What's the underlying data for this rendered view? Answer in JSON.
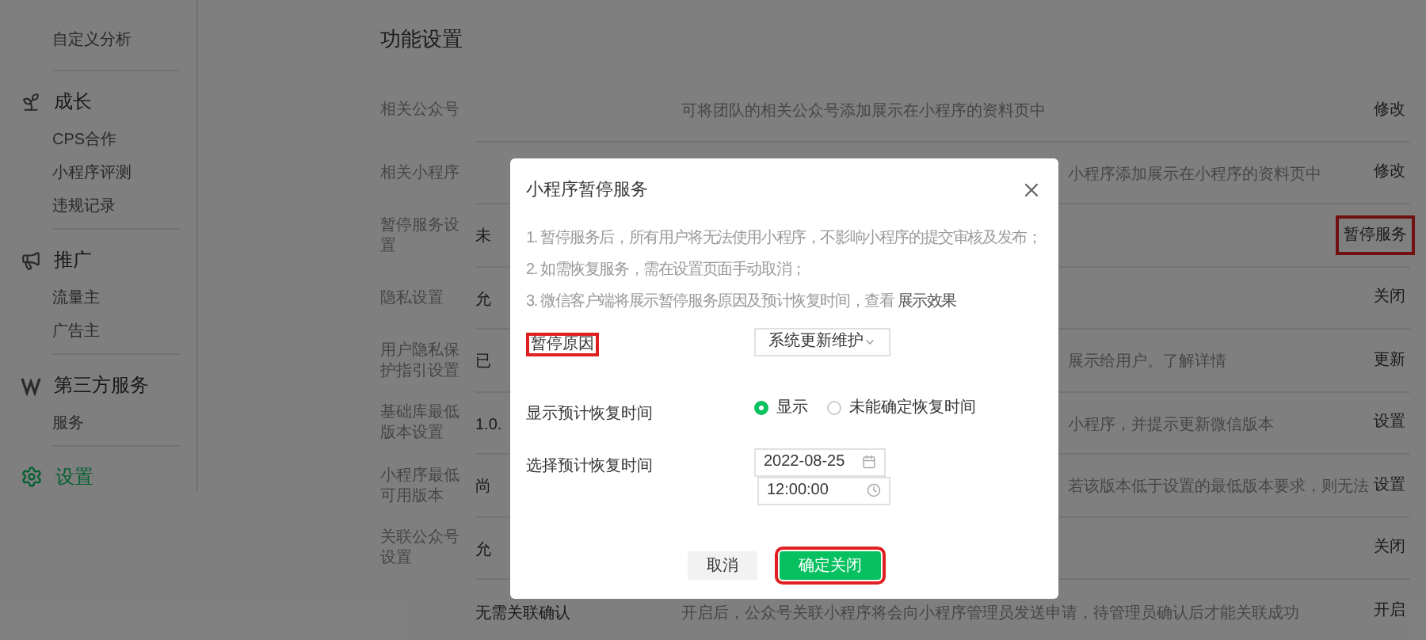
{
  "sidebar": {
    "top_items": [
      {
        "label": "自定义分析",
        "selected": false
      }
    ],
    "groups": [
      {
        "kind": "growth",
        "title": "成长",
        "selected": false,
        "items": [
          {
            "label": "CPS合作",
            "selected": false
          },
          {
            "label": "小程序评测",
            "selected": false
          },
          {
            "label": "违规记录",
            "selected": false
          }
        ]
      },
      {
        "kind": "promotion",
        "title": "推广",
        "selected": false,
        "items": [
          {
            "label": "流量主",
            "selected": false
          },
          {
            "label": "广告主",
            "selected": false
          }
        ]
      },
      {
        "kind": "third_party",
        "title": "第三方服务",
        "selected": false,
        "items": [
          {
            "label": "服务",
            "selected": false
          }
        ]
      },
      {
        "kind": "settings",
        "title": "设置",
        "selected": true
      }
    ]
  },
  "section_title": "功能设置",
  "rows": [
    {
      "label": "相关公众号",
      "description": "可将团队的相关公众号添加展示在小程序的资料页中",
      "action": "修改",
      "highlighted": false
    },
    {
      "label": "相关小程序",
      "description_tail": "小程序添加展示在小程序的资料页中",
      "action": "修改",
      "highlighted": false
    },
    {
      "label": "暂停服务设置",
      "value": "未",
      "action": "暂停服务",
      "highlighted": true
    },
    {
      "label": "隐私设置",
      "value": "允",
      "action": "关闭",
      "highlighted": false
    },
    {
      "label": "用户隐私保护指引设置",
      "value": "已",
      "description_tail": "展示给用户。了解详情",
      "action": "更新",
      "highlighted": false
    },
    {
      "label": "基础库最低版本设置",
      "value": "1.0.",
      "description_tail": "小程序，并提示更新微信版本",
      "action": "设置",
      "highlighted": false
    },
    {
      "label": "小程序最低可用版本",
      "value": "尚",
      "description_tail": "若该版本低于设置的最低版本要求，则无法",
      "action": "设置",
      "highlighted": false
    },
    {
      "label": "关联公众号设置",
      "value": "允",
      "action": "关闭",
      "highlighted": false
    },
    {
      "value": "无需关联确认",
      "description": "开启后，公众号关联小程序将会向小程序管理员发送申请，待管理员确认后才能关联成功",
      "action": "开启",
      "highlighted": false
    }
  ],
  "dialog": {
    "title": "小程序暂停服务",
    "notes": [
      "1. 暂停服务后，所有用户将无法使用小程序，不影响小程序的提交审核及发布；",
      "2. 如需恢复服务，需在设置页面手动取消；",
      "3. 微信客户端将展示暂停服务原因及预计恢复时间，查看 **展示效果**"
    ],
    "reason": {
      "label": "暂停原因",
      "highlighted": true,
      "value": "系统更新维护"
    },
    "show_time": {
      "label": "显示预计恢复时间",
      "options": [
        {
          "label": "显示",
          "selected": true
        },
        {
          "label": "未能确定恢复时间",
          "selected": false
        }
      ]
    },
    "pick_time": {
      "label": "选择预计恢复时间",
      "date": "2022-08-25",
      "time": "12:00:00"
    },
    "buttons": [
      {
        "kind": "secondary",
        "label": "取消",
        "highlighted": false
      },
      {
        "kind": "primary",
        "label": "确定关闭",
        "highlighted": true
      }
    ]
  }
}
